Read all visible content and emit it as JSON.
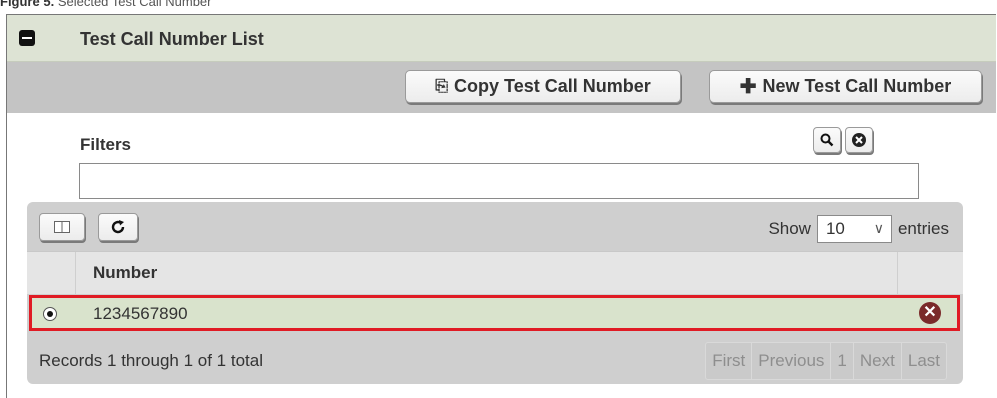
{
  "caption": {
    "prefix": "Figure 5.",
    "text": "Selected Test Call Number"
  },
  "panel": {
    "title": "Test Call Number List"
  },
  "toolbar": {
    "copy_label": "Copy Test Call Number",
    "new_label": "New Test Call Number"
  },
  "filters": {
    "label": "Filters",
    "value": ""
  },
  "table": {
    "show_label": "Show",
    "entries_label": "entries",
    "page_size": "10",
    "column_number": "Number",
    "rows": [
      {
        "number": "1234567890",
        "selected": true
      }
    ],
    "records_text": "Records 1 through 1 of 1 total",
    "pager": {
      "first": "First",
      "previous": "Previous",
      "page": "1",
      "next": "Next",
      "last": "Last"
    }
  },
  "colors": {
    "selected_row": "#d9e3cc",
    "highlight_border": "#e01b24",
    "header_bg": "#dde3d4"
  }
}
